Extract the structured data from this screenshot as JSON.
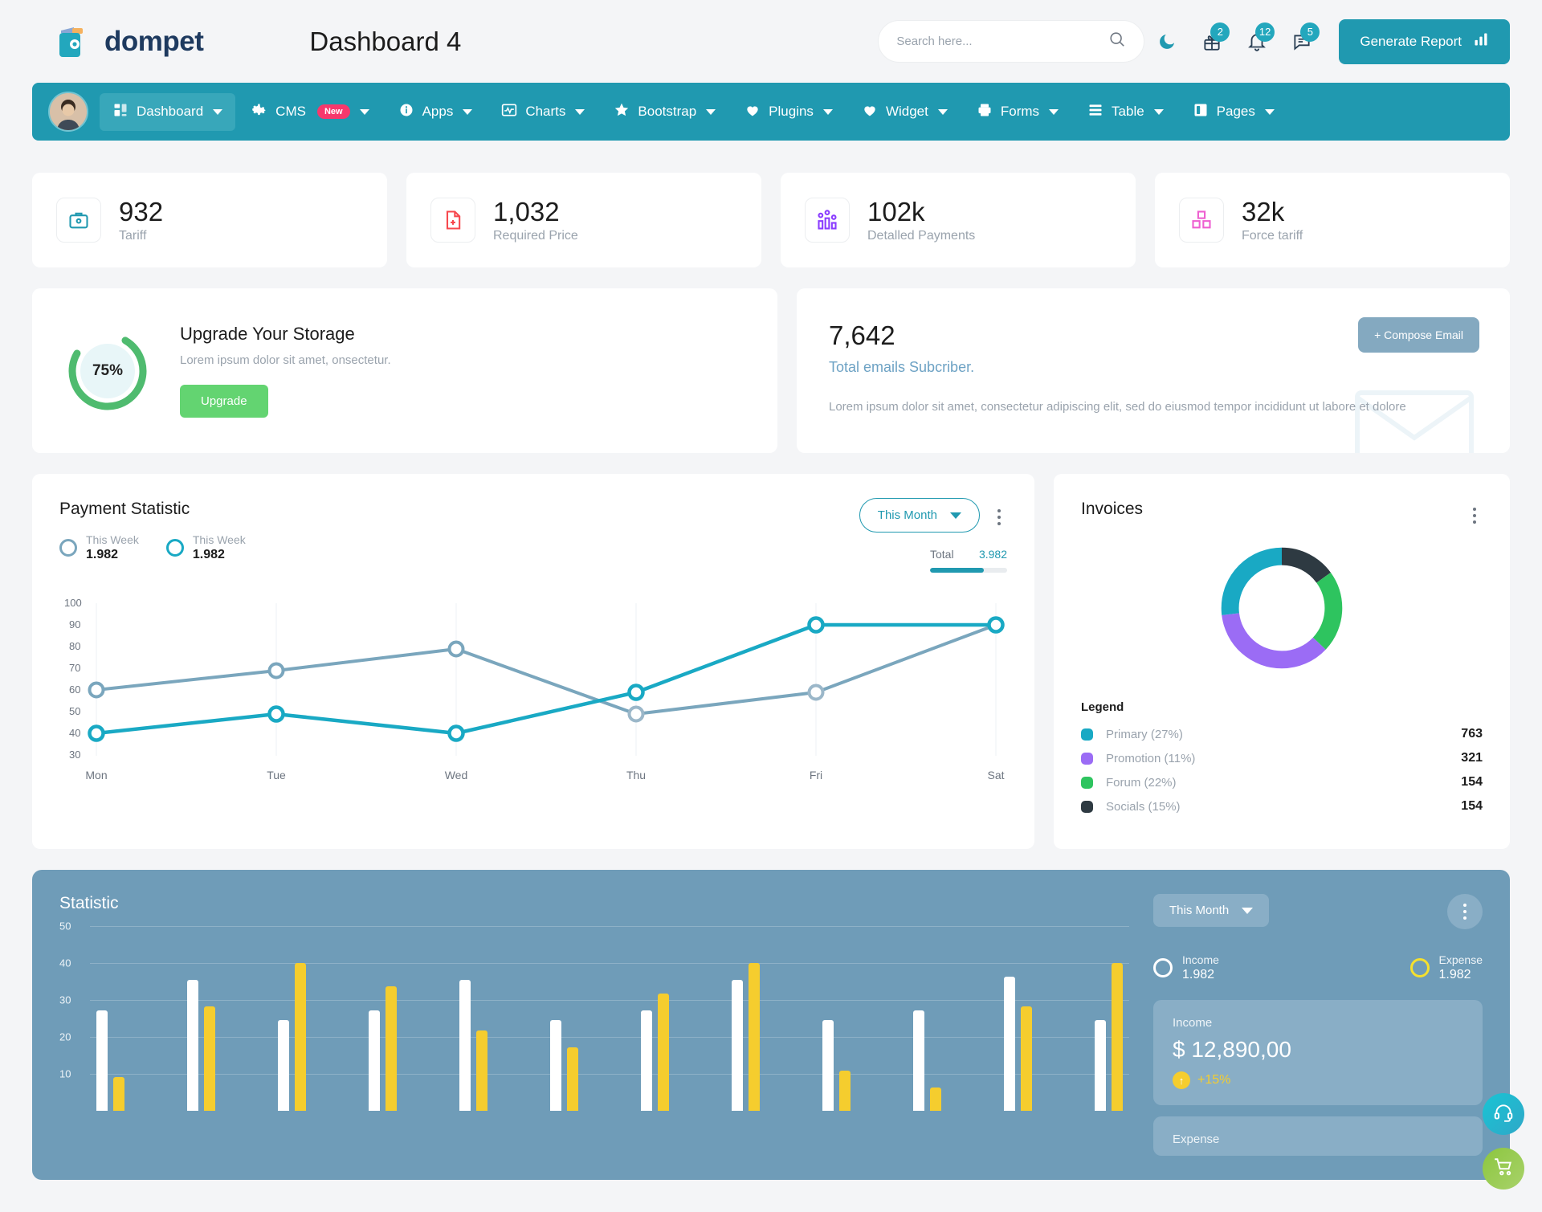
{
  "header": {
    "brand": "dompet",
    "brand_icon": "wallet-logo-icon",
    "page_title": "Dashboard 4",
    "search_placeholder": "Search here...",
    "search_value": "",
    "search_icon": "search-icon",
    "dark_mode_icon": "moon-icon",
    "gift_icon": "gift-icon",
    "gift_badge": "2",
    "bell_icon": "bell-icon",
    "bell_badge": "12",
    "message_icon": "message-icon",
    "message_badge": "5",
    "generate_report": "Generate Report",
    "report_icon": "bar-chart-icon",
    "accent": "#2099b0"
  },
  "nav": {
    "avatar_name": "user-avatar",
    "items": [
      {
        "label": "Dashboard",
        "icon": "grid-icon",
        "active": true,
        "caret": true
      },
      {
        "label": "CMS",
        "icon": "gear-icon",
        "active": false,
        "caret": true,
        "badge": "New"
      },
      {
        "label": "Apps",
        "icon": "info-icon",
        "active": false,
        "caret": true
      },
      {
        "label": "Charts",
        "icon": "activity-icon",
        "active": false,
        "caret": true
      },
      {
        "label": "Bootstrap",
        "icon": "star-icon",
        "active": false,
        "caret": true
      },
      {
        "label": "Plugins",
        "icon": "heart-icon",
        "active": false,
        "caret": true
      },
      {
        "label": "Widget",
        "icon": "heart-icon",
        "active": false,
        "caret": true
      },
      {
        "label": "Forms",
        "icon": "printer-icon",
        "active": false,
        "caret": true
      },
      {
        "label": "Table",
        "icon": "list-icon",
        "active": false,
        "caret": true
      },
      {
        "label": "Pages",
        "icon": "book-icon",
        "active": false,
        "caret": true
      }
    ]
  },
  "stats": [
    {
      "value": "932",
      "label": "Tariff",
      "icon": "briefcase-icon",
      "color": "#2099b0"
    },
    {
      "value": "1,032",
      "label": "Required Price",
      "icon": "file-medical-icon",
      "color": "#f7484e"
    },
    {
      "value": "102k",
      "label": "Detalled Payments",
      "icon": "chart-bars-icon",
      "color": "#8b3dff"
    },
    {
      "value": "32k",
      "label": "Force tariff",
      "icon": "boxes-icon",
      "color": "#ee5fd0"
    }
  ],
  "storage": {
    "percent_label": "75%",
    "percent": 75,
    "title": "Upgrade Your Storage",
    "subtitle": "Lorem ipsum dolor sit amet, onsectetur.",
    "button": "Upgrade",
    "ring_color": "#4fbb6f"
  },
  "email": {
    "count": "7,642",
    "subtitle": "Total emails Subcriber.",
    "description": "Lorem ipsum dolor sit amet, consectetur adipiscing elit, sed do eiusmod tempor incididunt ut labore et dolore",
    "compose_button": "+ Compose Email",
    "envelope_icon": "envelope-icon"
  },
  "payment": {
    "title": "Payment Statistic",
    "legend": [
      {
        "name": "This Week",
        "value": "1.982",
        "color": "#7aa6bd"
      },
      {
        "name": "This Week",
        "value": "1.982",
        "color": "#19a9c4"
      }
    ],
    "period": "This Month",
    "total_label": "Total",
    "total_value": "3.982",
    "total_percent": 70,
    "kebab_icon": "kebab-menu-icon"
  },
  "invoices": {
    "title": "Invoices",
    "legend_header": "Legend",
    "kebab_icon": "kebab-menu-icon",
    "legend": [
      {
        "label": "Primary (27%)",
        "amount": "763",
        "color": "#19a9c4",
        "percent": 27
      },
      {
        "label": "Promotion (11%)",
        "amount": "321",
        "color": "#9b6cf5",
        "percent": 11
      },
      {
        "label": "Forum (22%)",
        "amount": "154",
        "color": "#2ec45f",
        "percent": 22
      },
      {
        "label": "Socials (15%)",
        "amount": "154",
        "color": "#2e3a42",
        "percent": 15
      }
    ]
  },
  "statistic": {
    "title": "Statistic",
    "period": "This Month",
    "kebab_icon": "kebab-menu-icon",
    "legend": [
      {
        "name": "Income",
        "value": "1.982",
        "color": "#ffffff"
      },
      {
        "name": "Expense",
        "value": "1.982",
        "color": "#f5e02e"
      }
    ],
    "income_label": "Income",
    "income_value": "$ 12,890,00",
    "income_change": "+15%",
    "income_arrow": "arrow-up-icon",
    "expense_label": "Expense"
  },
  "fab": {
    "support_icon": "headset-icon",
    "cart_icon": "shopping-cart-icon"
  },
  "chart_data": [
    {
      "type": "line",
      "title": "Payment Statistic",
      "x": [
        "Mon",
        "Tue",
        "Wed",
        "Thu",
        "Fri",
        "Sat"
      ],
      "xlabel": "",
      "ylabel": "",
      "ylim": [
        30,
        100
      ],
      "yticks": [
        30,
        40,
        50,
        60,
        70,
        80,
        90,
        100
      ],
      "grid": true,
      "legend_position": "top-left",
      "series": [
        {
          "name": "This Week",
          "color": "#19a9c4",
          "values": [
            40,
            49,
            40,
            59,
            89,
            89
          ]
        },
        {
          "name": "This Week",
          "color": "#7aa6bd",
          "values": [
            60,
            69,
            79,
            49,
            59,
            89
          ]
        }
      ]
    },
    {
      "type": "pie",
      "title": "Invoices",
      "labels": [
        "Socials (15%)",
        "Forum (22%)",
        "Promotion (11%)",
        "Primary (27%)"
      ],
      "values": [
        15,
        22,
        36,
        27
      ],
      "amounts": [
        "154",
        "154",
        "321",
        "763"
      ],
      "colors": [
        "#2e3a42",
        "#2ec45f",
        "#9b6cf5",
        "#19a9c4"
      ],
      "legend_position": "bottom"
    },
    {
      "type": "bar",
      "title": "Statistic",
      "categories": [
        "1",
        "2",
        "3",
        "4",
        "5",
        "6",
        "7",
        "8",
        "9",
        "10",
        "11",
        "12"
      ],
      "ylim": [
        0,
        55
      ],
      "yticks": [
        10,
        20,
        30,
        40,
        50
      ],
      "grid": true,
      "series": [
        {
          "name": "Income",
          "color": "#ffffff",
          "values": [
            30,
            39,
            27,
            30,
            39,
            27,
            30,
            39,
            27,
            30,
            40,
            27
          ]
        },
        {
          "name": "Expense",
          "color": "#f5cd2e",
          "values": [
            10,
            31,
            44,
            37,
            24,
            19,
            35,
            44,
            12,
            7,
            31,
            44
          ]
        }
      ]
    }
  ]
}
